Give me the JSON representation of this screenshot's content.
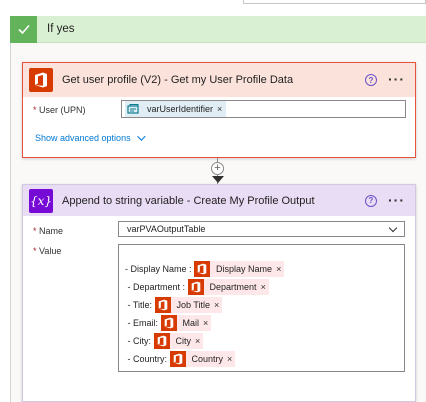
{
  "condition": {
    "label": "If yes"
  },
  "card1": {
    "title": "Get user profile (V2) - Get my User Profile Data",
    "help": "?",
    "more": "···",
    "field_label": "User (UPN)",
    "required_mark": "*",
    "token": {
      "label": "varUserIdentifier",
      "remove": "×"
    },
    "advanced": "Show advanced options"
  },
  "connector": {
    "plus": "+"
  },
  "card2": {
    "icon_text": "{x}",
    "title": "Append to string variable - Create My Profile Output",
    "help": "?",
    "more": "···",
    "name_label": "Name",
    "name_value": "varPVAOutputTable",
    "value_label": "Value",
    "required_mark": "*",
    "lines": [
      {
        "prefix": "- Display Name : ",
        "token": "Display Name",
        "remove": "×"
      },
      {
        "prefix": " - Department : ",
        "token": "Department",
        "remove": "×"
      },
      {
        "prefix": " - Title: ",
        "token": "Job Title",
        "remove": "×"
      },
      {
        "prefix": " - Email: ",
        "token": "Mail",
        "remove": "×"
      },
      {
        "prefix": " - City: ",
        "token": "City",
        "remove": "×"
      },
      {
        "prefix": " - Country: ",
        "token": "Country",
        "remove": "×"
      }
    ]
  },
  "colors": {
    "office": "#d83b01",
    "variable": "#770bd6",
    "success": "#63b35b"
  }
}
